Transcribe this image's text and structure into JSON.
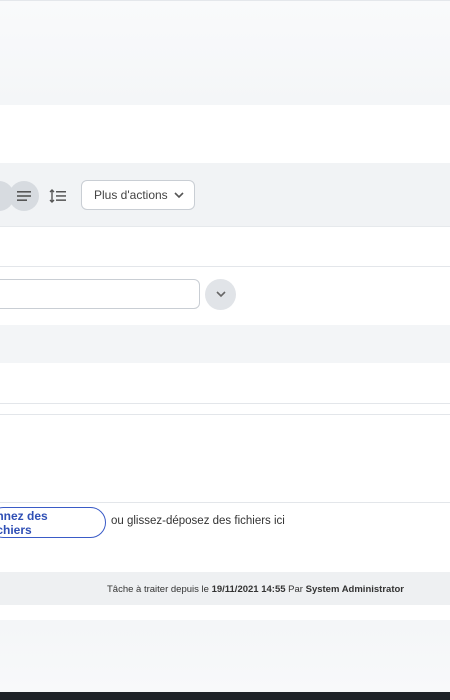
{
  "toolbar": {
    "more_actions_label": "Plus d'actions",
    "icons": [
      "format-icon",
      "align-left-icon",
      "line-spacing-icon",
      "chevron-down-icon"
    ]
  },
  "attachments": {
    "select_files_label": "onnez des fichiers",
    "drop_hint": "ou glissez-déposez des fichiers ici"
  },
  "status": {
    "prefix": "Tâche à traiter depuis le",
    "date": "19/11/2021 14:55",
    "by": "Par",
    "user": "System Administrator"
  },
  "colors": {
    "accent": "#2f4fb5",
    "toolbar_bg": "#f1f3f5",
    "status_bg": "#eef0f2"
  }
}
